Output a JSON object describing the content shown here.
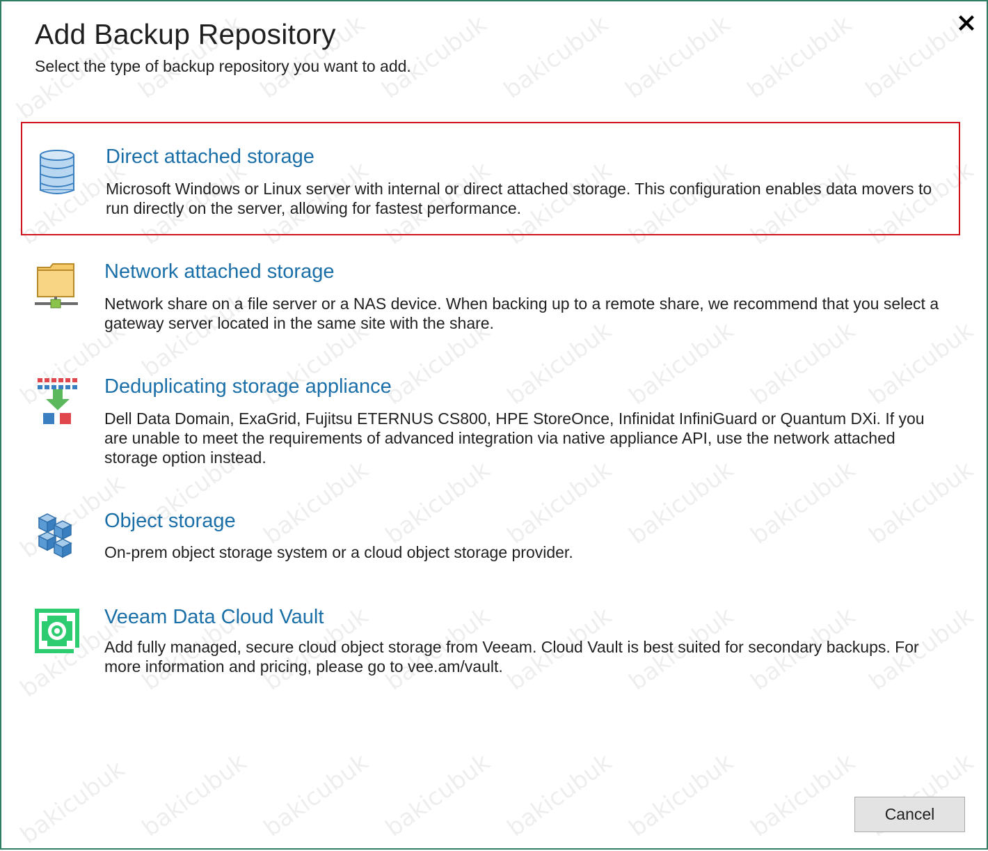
{
  "dialog": {
    "title": "Add Backup Repository",
    "subtitle": "Select the type of backup repository you want to add.",
    "close_label": "✖",
    "watermark": "bakicubuk"
  },
  "options": [
    {
      "title": "Direct attached storage",
      "description": "Microsoft Windows or Linux server with internal or direct attached storage. This configuration enables data movers to run directly on the server, allowing for fastest performance.",
      "icon": "database-icon",
      "selected": true
    },
    {
      "title": "Network attached storage",
      "description": "Network share on a file server or a NAS device. When backing up to a remote share, we recommend that you select a gateway server located in the same site with the share.",
      "icon": "network-folder-icon",
      "selected": false
    },
    {
      "title": "Deduplicating storage appliance",
      "description": "Dell Data Domain, ExaGrid, Fujitsu ETERNUS CS800, HPE StoreOnce, Infinidat InfiniGuard or Quantum DXi. If you are unable to meet the requirements of advanced integration via native appliance API, use the network attached storage option instead.",
      "icon": "deduplication-icon",
      "selected": false
    },
    {
      "title": "Object storage",
      "description": "On-prem object storage system or a cloud object storage provider.",
      "icon": "object-storage-cubes-icon",
      "selected": false
    },
    {
      "title": "Veeam Data Cloud Vault",
      "description": "Add fully managed, secure cloud object storage from Veeam. Cloud Vault is best suited for secondary backups. For more information and pricing, please go to vee.am/vault.",
      "icon": "veeam-vault-icon",
      "selected": false
    }
  ],
  "footer": {
    "cancel_label": "Cancel"
  },
  "colors": {
    "accent_link": "#1a6fa8",
    "selection_border": "#d0121b",
    "frame_border": "#2f7d63",
    "veeam_green": "#2ecc71"
  }
}
